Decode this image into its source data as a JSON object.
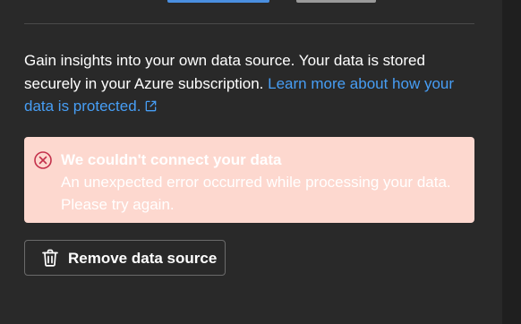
{
  "description": {
    "text": "Gain insights into your own data source. Your data is stored securely in your Azure subscription. ",
    "link_text": "Learn more about how your data is protected."
  },
  "error": {
    "title": "We couldn't connect your data",
    "message": "An unexpected error occurred while processing your data. Please try again."
  },
  "actions": {
    "remove_label": "Remove data source"
  },
  "icons": {
    "external_link": "open-in-new-icon",
    "error": "dismiss-circle-icon",
    "remove": "trash-icon"
  },
  "colors": {
    "background": "#292929",
    "link": "#479ef5",
    "error_background": "#fdd8cf",
    "error_icon": "#c4314b",
    "primary_accent": "#4a8fe0"
  }
}
